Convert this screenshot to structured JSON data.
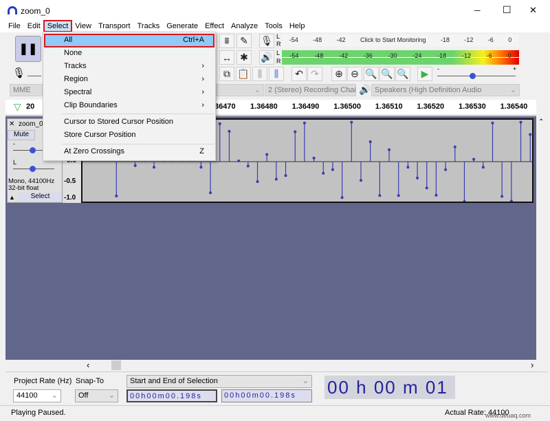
{
  "window": {
    "title": "zoom_0",
    "minimize": "─",
    "maximize": "☐",
    "close": "✕"
  },
  "menubar": [
    "File",
    "Edit",
    "Select",
    "View",
    "Transport",
    "Tracks",
    "Generate",
    "Effect",
    "Analyze",
    "Tools",
    "Help"
  ],
  "active_menu": "Select",
  "select_menu": {
    "items": [
      {
        "label": "All",
        "shortcut": "Ctrl+A",
        "highlighted": true
      },
      {
        "label": "None"
      },
      {
        "label": "Tracks",
        "submenu": true
      },
      {
        "label": "Region",
        "submenu": true
      },
      {
        "label": "Spectral",
        "submenu": true
      },
      {
        "label": "Clip Boundaries",
        "submenu": true
      },
      {
        "label": "Cursor to Stored Cursor Position"
      },
      {
        "label": "Store Cursor Position"
      },
      {
        "label": "At Zero Crossings",
        "shortcut": "Z"
      }
    ],
    "submenu_arrow": "›"
  },
  "meters": {
    "record_labels": [
      "-54",
      "-48",
      "-42",
      "Click to Start Monitoring",
      "-18",
      "-12",
      "-6",
      "0"
    ],
    "play_labels": [
      "-54",
      "-48",
      "-42",
      "-36",
      "-30",
      "-24",
      "-18",
      "-12",
      "-6",
      "0"
    ],
    "L": "L",
    "R": "R"
  },
  "devices": {
    "host": "MME",
    "input_channels": "2 (Stereo) Recording Chai",
    "output": "Speakers (High Definition Audio"
  },
  "speed_slider": {
    "minus": "-",
    "plus": "+",
    "level": 0.45
  },
  "ruler": {
    "partial_left": "20",
    "labels": [
      "36470",
      "1.36480",
      "1.36490",
      "1.36500",
      "1.36510",
      "1.36520",
      "1.36530",
      "1.36540"
    ]
  },
  "track": {
    "close": "✕",
    "name": "zoom_0",
    "mute": "Mute",
    "pan_l": "L",
    "pan_r": "R",
    "gain_minus": "-",
    "info1": "Mono, 44100Hz",
    "info2": "32-bit float",
    "select": "Select",
    "collapse": "▲",
    "axis": [
      "0.0",
      "-0.5",
      "-1.0"
    ],
    "samples": [
      -0.86,
      0.6,
      -0.1,
      0.4,
      -0.14,
      0.7,
      0.3,
      0.8,
      0.2,
      -0.14,
      -0.78,
      0.95,
      0.76,
      0.02,
      -0.11,
      -0.5,
      0.18,
      -0.44,
      -0.35,
      0.75,
      0.97,
      0.09,
      -0.29,
      -0.2,
      -0.9,
      0.99,
      -0.47,
      0.5,
      -0.85,
      0.3,
      -0.85,
      -0.14,
      -0.41,
      -0.66,
      -0.84,
      -0.2,
      0.37,
      -1.0,
      0.06,
      -0.14,
      0.97,
      -0.87,
      -0.99,
      0.99,
      0.68
    ],
    "wave_color": "#3b3bb0"
  },
  "hscroll": {
    "left": "‹",
    "right": "›"
  },
  "selection_toolbar": {
    "project_rate_label": "Project Rate (Hz)",
    "project_rate": "44100",
    "snap_label": "Snap-To",
    "snap": "Off",
    "mode": "Start and End of Selection",
    "start": "00h00m00.198s",
    "end": "00h00m00.198s",
    "audio_position": "00 h 00 m 01 s"
  },
  "status": {
    "left": "Playing Paused.",
    "right": "Actual Rate: 44100"
  },
  "watermark": "www.deuaq.com"
}
